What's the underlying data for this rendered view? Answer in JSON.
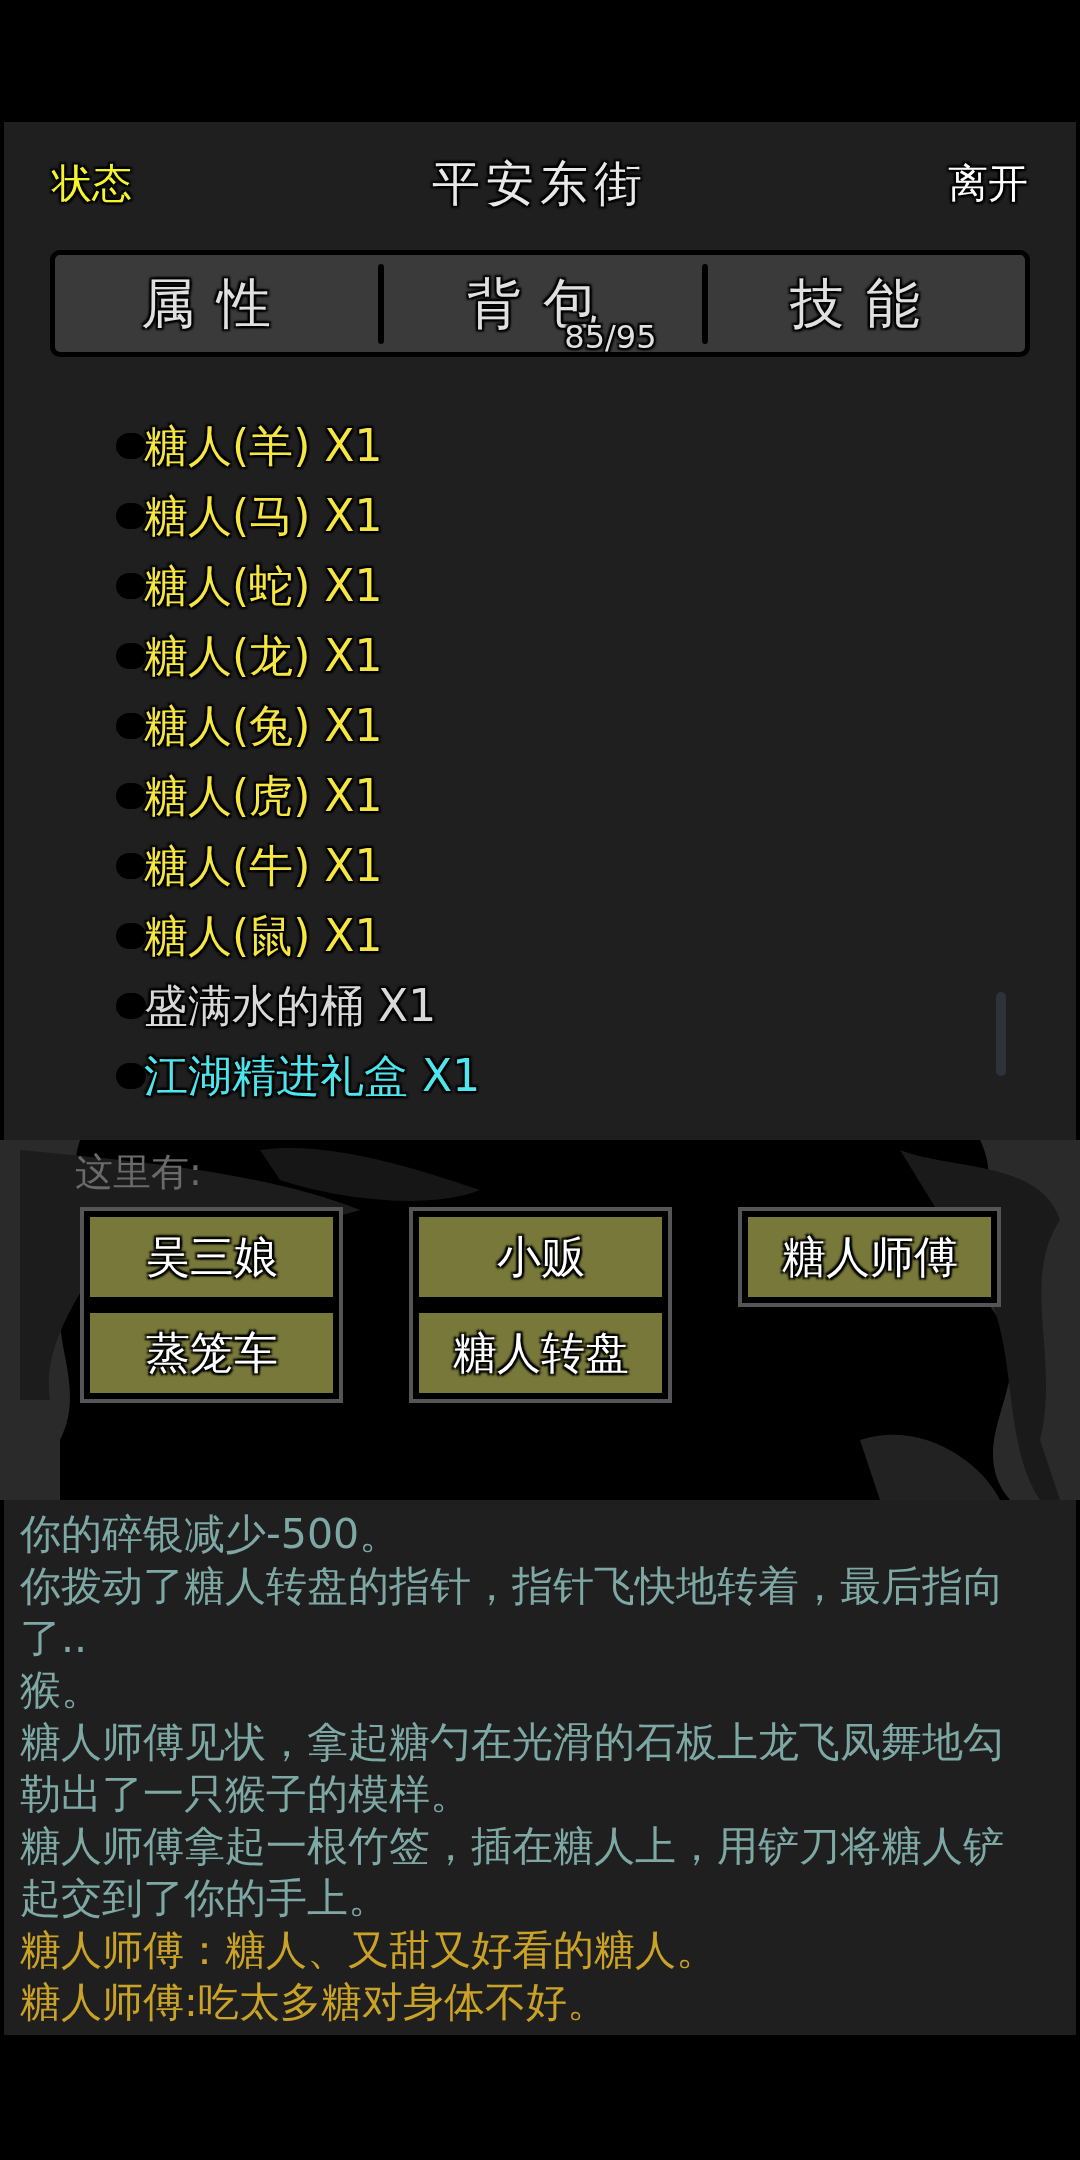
{
  "header": {
    "status_link": "状态",
    "title": "平安东街",
    "leave_link": "离开"
  },
  "tabs": [
    {
      "label": "属性"
    },
    {
      "label": "背包",
      "count": "85/95"
    },
    {
      "label": "技能"
    }
  ],
  "inventory": [
    {
      "name": "糖人(羊) X1",
      "color": "#f5e642"
    },
    {
      "name": "糖人(马) X1",
      "color": "#f5e642"
    },
    {
      "name": "糖人(蛇) X1",
      "color": "#f5e642"
    },
    {
      "name": "糖人(龙) X1",
      "color": "#f5e642"
    },
    {
      "name": "糖人(兔) X1",
      "color": "#f5e642"
    },
    {
      "name": "糖人(虎) X1",
      "color": "#f5e642"
    },
    {
      "name": "糖人(牛) X1",
      "color": "#f5e642"
    },
    {
      "name": "糖人(鼠) X1",
      "color": "#f5e642"
    },
    {
      "name": "盛满水的桶 X1",
      "color": "#d8d8d8"
    },
    {
      "name": "江湖精进礼盒 X1",
      "color": "#4ee6ee"
    }
  ],
  "here": {
    "label": "这里有:",
    "columns": [
      [
        "吴三娘",
        "蒸笼车"
      ],
      [
        "小贩",
        "糖人转盘"
      ],
      [
        "糖人师傅"
      ]
    ]
  },
  "log": [
    {
      "text": "你的碎银减少-500。",
      "kind": "narration"
    },
    {
      "text": "你拨动了糖人转盘的指针，指针飞快地转着，最后指向了..",
      "kind": "narration"
    },
    {
      "text": "猴。",
      "kind": "narration"
    },
    {
      "text": "糖人师傅见状，拿起糖勺在光滑的石板上龙飞凤舞地勾勒出了一只猴子的模样。",
      "kind": "narration"
    },
    {
      "text": "糖人师傅拿起一根竹签，插在糖人上，用铲刀将糖人铲起交到了你的手上。",
      "kind": "narration"
    },
    {
      "text": "糖人师傅：糖人、又甜又好看的糖人。",
      "kind": "speech"
    },
    {
      "text": "糖人师傅:吃太多糖对身体不好。",
      "kind": "speech"
    }
  ]
}
